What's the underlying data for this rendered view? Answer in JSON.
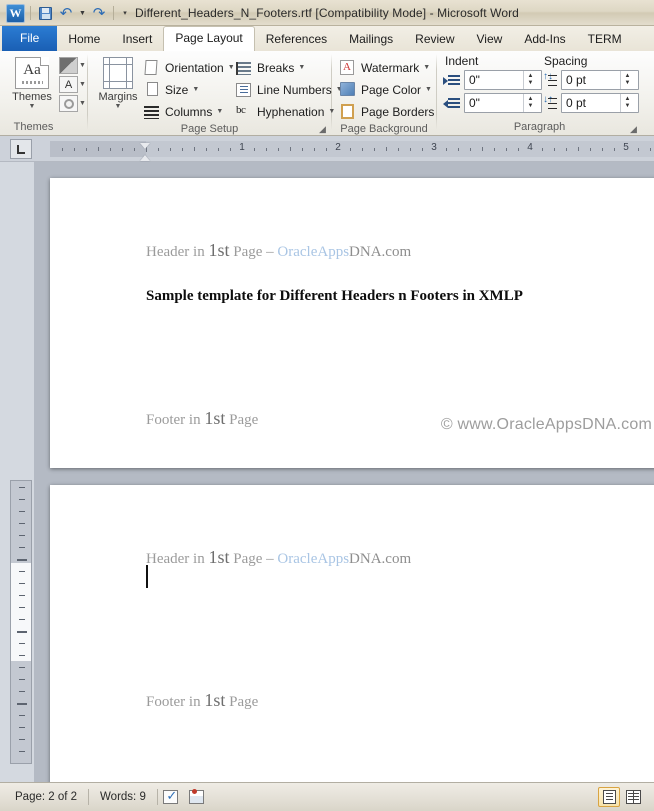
{
  "window": {
    "title": "Different_Headers_N_Footers.rtf [Compatibility Mode]  -  Microsoft Word",
    "app_icon": "word-icon",
    "app_initial": "W"
  },
  "quick_access": {
    "items": [
      {
        "name": "save-button",
        "icon": "floppy-disk-icon",
        "label": "Save"
      },
      {
        "name": "undo-button",
        "icon": "undo-arrow-icon",
        "label": "Undo"
      },
      {
        "name": "redo-button",
        "icon": "redo-arrow-icon",
        "label": "Redo"
      },
      {
        "name": "customize-qat-button",
        "icon": "chevron-down-icon",
        "label": "Customize Quick Access Toolbar"
      }
    ]
  },
  "ribbon": {
    "tabs": [
      {
        "label": "File",
        "active": false,
        "file": true
      },
      {
        "label": "Home",
        "active": false
      },
      {
        "label": "Insert",
        "active": false
      },
      {
        "label": "Page Layout",
        "active": true
      },
      {
        "label": "References",
        "active": false
      },
      {
        "label": "Mailings",
        "active": false
      },
      {
        "label": "Review",
        "active": false
      },
      {
        "label": "View",
        "active": false
      },
      {
        "label": "Add-Ins",
        "active": false
      },
      {
        "label": "TERM",
        "active": false
      }
    ],
    "groups": {
      "themes": {
        "label": "Themes",
        "main_button": "Themes",
        "main_glyph": "Aa",
        "side_buttons": [
          {
            "name": "theme-colors-button",
            "icon": "color-swatch-icon"
          },
          {
            "name": "theme-fonts-button",
            "icon": "letter-a-icon",
            "glyph": "A"
          },
          {
            "name": "theme-effects-button",
            "icon": "circle-effect-icon"
          }
        ]
      },
      "page_setup": {
        "label": "Page Setup",
        "margins_label": "Margins",
        "items": [
          {
            "label": "Orientation",
            "icon": "page-orientation-icon",
            "dropdown": true
          },
          {
            "label": "Size",
            "icon": "page-size-icon",
            "dropdown": true
          },
          {
            "label": "Columns",
            "icon": "columns-icon",
            "dropdown": true
          },
          {
            "label": "Breaks",
            "icon": "page-breaks-icon",
            "dropdown": true
          },
          {
            "label": "Line Numbers",
            "icon": "line-numbers-icon",
            "dropdown": true
          },
          {
            "label": "Hyphenation",
            "icon": "hyphenation-icon",
            "glyph": "bc",
            "dropdown": true
          }
        ],
        "dialog_launcher": "page-setup-dialog-launcher"
      },
      "page_background": {
        "label": "Page Background",
        "items": [
          {
            "label": "Watermark",
            "icon": "watermark-icon",
            "dropdown": true
          },
          {
            "label": "Page Color",
            "icon": "page-color-icon",
            "dropdown": true
          },
          {
            "label": "Page Borders",
            "icon": "page-borders-icon",
            "dropdown": false
          }
        ]
      },
      "paragraph": {
        "label": "Paragraph",
        "indent_label": "Indent",
        "spacing_label": "Spacing",
        "indent_left_value": "0\"",
        "indent_right_value": "0\"",
        "spacing_before_value": "0 pt",
        "spacing_after_value": "0 pt",
        "dialog_launcher": "paragraph-dialog-launcher"
      }
    }
  },
  "ruler": {
    "tab_selector": "left-tab-stop-icon",
    "numbers": [
      "1",
      "2",
      "3",
      "4",
      "5"
    ],
    "unit": "inches"
  },
  "document": {
    "pages": [
      {
        "name": "page-1",
        "header": {
          "prefix": "Header in ",
          "big": "1st",
          "middle": " Page – ",
          "brand_blue": "OracleApps",
          "brand_gray": "DNA.com"
        },
        "body": "Sample template for Different Headers n Footers in XMLP",
        "footer": {
          "prefix": "Footer in ",
          "big": "1st",
          "suffix": " Page"
        },
        "watermark": "© www.OracleAppsDNA.com",
        "has_caret": false
      },
      {
        "name": "page-2",
        "header": {
          "prefix": "Header in ",
          "big": "1st",
          "middle": " Page – ",
          "brand_blue": "OracleApps",
          "brand_gray": "DNA.com"
        },
        "body": "",
        "footer": {
          "prefix": "Footer in ",
          "big": "1st",
          "suffix": " Page"
        },
        "watermark": "",
        "has_caret": true
      }
    ]
  },
  "status_bar": {
    "page_indicator": "Page: 2 of 2",
    "word_count": "Words: 9",
    "proofing_icon": "spell-check-icon",
    "language_icon": "proofing-language-icon",
    "views": [
      {
        "name": "print-layout-view-button",
        "icon": "print-layout-icon",
        "selected": true
      },
      {
        "name": "full-screen-reading-view-button",
        "icon": "reading-view-icon",
        "selected": false
      }
    ]
  },
  "colors": {
    "file_tab": "#1a5fb4",
    "brand_blue": "#a9c5e4",
    "brand_gray": "#8e8e8e",
    "header_gray": "#9b9b9b",
    "watermark_gray": "#9d9d9d",
    "selected_view": "#d9a441"
  }
}
